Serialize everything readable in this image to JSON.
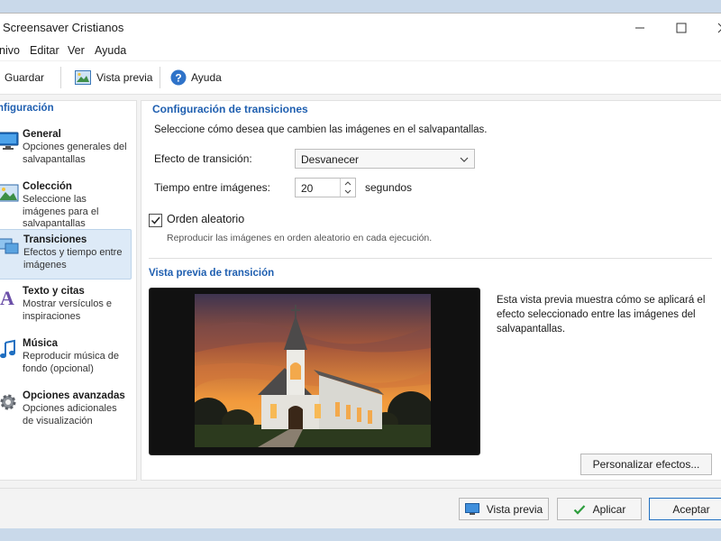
{
  "window": {
    "title": "Screensaver Cristianos"
  },
  "menu": [
    "nivo",
    "Editar",
    "Ver",
    "Ayuda"
  ],
  "toolbar": {
    "save": "Guardar",
    "preview": "Vista previa",
    "help": "Ayuda"
  },
  "sidebar": {
    "heading": "nfiguración",
    "items": [
      {
        "title": "General",
        "desc": "Opciones generales del salvapantallas",
        "icon": "monitor-icon"
      },
      {
        "title": "Colección",
        "desc": "Seleccione las imágenes para el salvapantallas",
        "icon": "image-icon"
      },
      {
        "title": "Transiciones",
        "desc": "Efectos y tiempo entre imágenes",
        "icon": "transitions-icon"
      },
      {
        "title": "Texto y citas",
        "desc": "Mostrar versículos e inspiraciones",
        "icon": "text-icon"
      },
      {
        "title": "Música",
        "desc": "Reproducir música de fondo (opcional)",
        "icon": "music-note-icon"
      },
      {
        "title": "Opciones avanzadas",
        "desc": "Opciones adicionales de visualización",
        "icon": "gear-icon"
      }
    ]
  },
  "panel": {
    "title": "Configuración de transiciones",
    "intro": "Seleccione cómo desea que cambien las imágenes en el salvapantallas.",
    "effect_label": "Efecto de transición:",
    "effect_value": "Desvanecer",
    "time_label": "Tiempo entre imágenes:",
    "time_value": "20",
    "time_unit": "segundos",
    "random_label": "Orden aleatorio",
    "random_checked": true,
    "random_help": "Reproducir las imágenes en orden aleatorio en cada ejecución.",
    "preview_title": "Vista previa de transición",
    "preview_desc": "Esta vista previa muestra cómo se aplicará el efecto seleccionado entre las imágenes del salvapantallas.",
    "customize": "Personalizar efectos..."
  },
  "buttons": {
    "preview": "Vista previa",
    "apply": "Aplicar",
    "ok": "Aceptar"
  },
  "colors": {
    "accent": "#1f5fb0",
    "active_bg": "#ddeaf7",
    "check_green": "#2e9e3e"
  }
}
